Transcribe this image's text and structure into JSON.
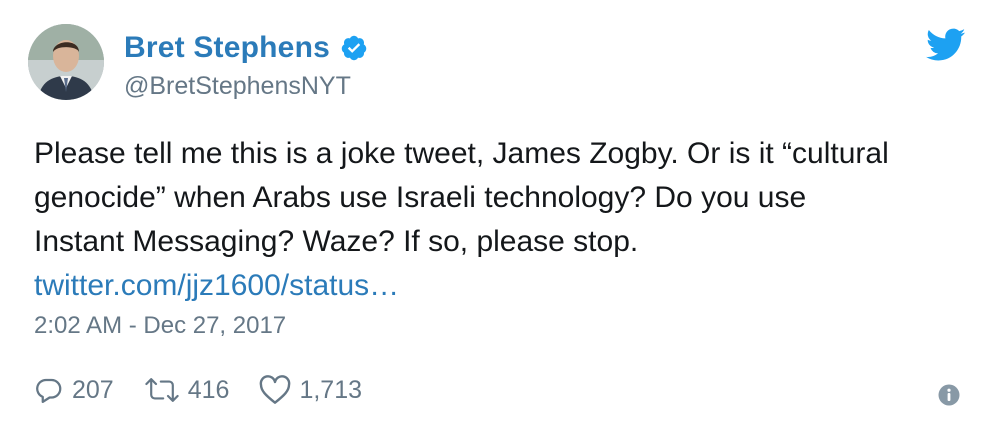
{
  "author": {
    "display_name": "Bret Stephens",
    "handle": "@BretStephensNYT",
    "verified": true
  },
  "tweet": {
    "text_lines": [
      "Please tell me this is a joke tweet, James Zogby. Or is it “cultural",
      "genocide” when Arabs use Israeli technology? Do you use",
      "Instant Messaging? Waze? If so, please stop."
    ],
    "link_text": "twitter.com/jjz1600/status…",
    "timestamp": "2:02 AM - Dec 27, 2017"
  },
  "actions": {
    "replies": "207",
    "retweets": "416",
    "likes": "1,713"
  },
  "colors": {
    "name": "#2b7bb9",
    "link": "#2b7bb9",
    "muted": "#657786",
    "text": "#14171a",
    "twitter_blue": "#1da1f2"
  },
  "icons": {
    "verified": "verified-badge-icon",
    "brand": "twitter-bird-icon",
    "reply": "reply-bubble-icon",
    "retweet": "retweet-icon",
    "like": "heart-icon",
    "info": "info-circle-icon"
  }
}
